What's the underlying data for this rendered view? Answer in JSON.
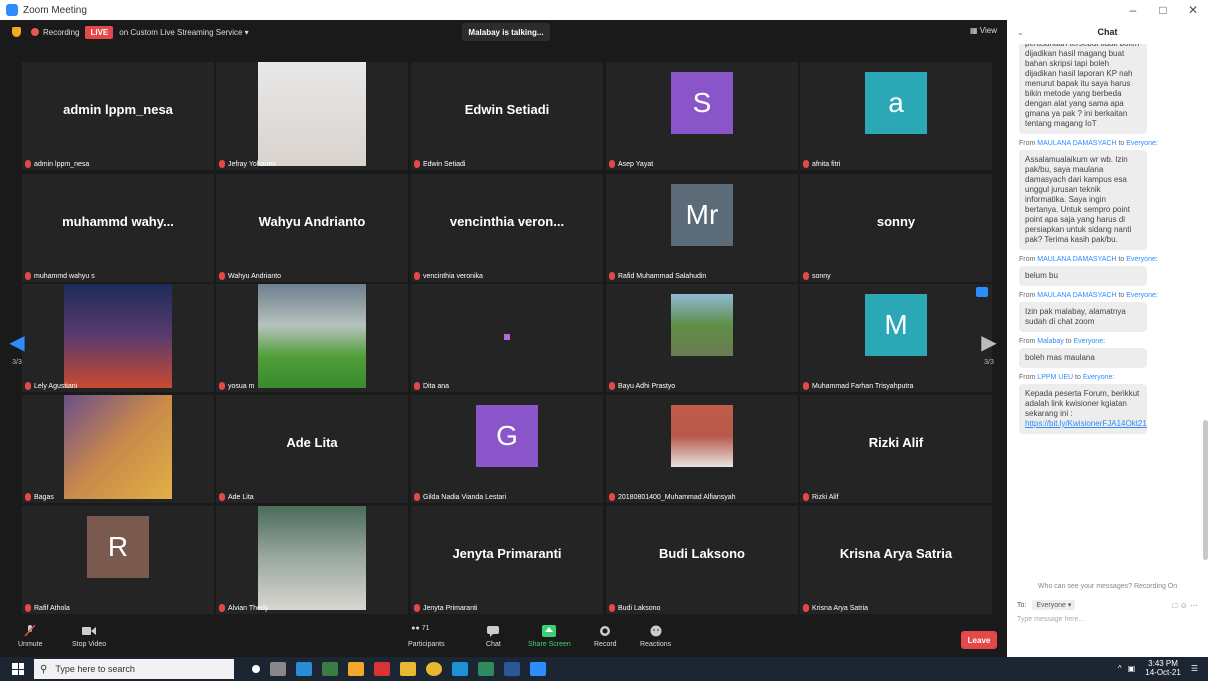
{
  "window": {
    "title": "Zoom Meeting"
  },
  "topbar": {
    "recording": "Recording",
    "live": "LIVE",
    "stream": "on Custom Live Streaming Service",
    "talking": "Malabay is talking...",
    "view": "View"
  },
  "tiles": [
    {
      "id": "t0",
      "display": "admin lppm_nesa",
      "label": "admin lppm_nesa",
      "kind": "name"
    },
    {
      "id": "t1",
      "display": "",
      "label": "Jefray Yohanes",
      "kind": "photo-cartoon"
    },
    {
      "id": "t2",
      "display": "Edwin Setiadi",
      "label": "Edwin Setiadi",
      "kind": "name"
    },
    {
      "id": "t3",
      "display": "S",
      "label": "Asep Yayat",
      "kind": "avatar",
      "color": "#8a55c9"
    },
    {
      "id": "t4",
      "display": "a",
      "label": "afnita fitri",
      "kind": "avatar",
      "color": "#2ba7b5"
    },
    {
      "id": "t5",
      "display": "muhammd  wahy...",
      "label": "muhammd wahyu s",
      "kind": "name"
    },
    {
      "id": "t6",
      "display": "Wahyu Andrianto",
      "label": "Wahyu Andrianto",
      "kind": "name"
    },
    {
      "id": "t7",
      "display": "vencinthia  veron...",
      "label": "vencinthia veronika",
      "kind": "name"
    },
    {
      "id": "t8",
      "display": "Mr",
      "label": "Rafid Muhammad Salahudin",
      "kind": "avatar",
      "color": "#5c6b78"
    },
    {
      "id": "t9",
      "display": "sonny",
      "label": "sonny",
      "kind": "name"
    },
    {
      "id": "t10",
      "display": "",
      "label": "Lely Agustiani",
      "kind": "photo-volcano"
    },
    {
      "id": "t11",
      "display": "",
      "label": "yosua m",
      "kind": "photo-landscape"
    },
    {
      "id": "t12",
      "display": "",
      "label": "Dita ana",
      "kind": "dot"
    },
    {
      "id": "t13",
      "display": "",
      "label": "Bayu Adhi Prastyo",
      "kind": "photo-field"
    },
    {
      "id": "t14",
      "display": "M",
      "label": "Muhammad Farhan Trisyahputra",
      "kind": "avatar",
      "color": "#2ba7b5"
    },
    {
      "id": "t15",
      "display": "",
      "label": "Bagas",
      "kind": "photo-game"
    },
    {
      "id": "t16",
      "display": "Ade Lita",
      "label": "Ade Lita",
      "kind": "name"
    },
    {
      "id": "t17",
      "display": "G",
      "label": "Gilda Nadia Vianda Lestari",
      "kind": "avatar",
      "color": "#8a55c9"
    },
    {
      "id": "t18",
      "display": "",
      "label": "20180801400_Muhammad Alfiansyah",
      "kind": "photo-portrait"
    },
    {
      "id": "t19",
      "display": "Rizki Alif",
      "label": "Rizki Alif",
      "kind": "name"
    },
    {
      "id": "t20",
      "display": "R",
      "label": "Rafif Athola",
      "kind": "avatar",
      "color": "#7a5a4e"
    },
    {
      "id": "t21",
      "display": "",
      "label": "Alvian Thedy",
      "kind": "photo-people"
    },
    {
      "id": "t22",
      "display": "Jenyta Primaranti",
      "label": "Jenyta Primaranti",
      "kind": "name"
    },
    {
      "id": "t23",
      "display": "Budi Laksono",
      "label": "Budi Laksono",
      "kind": "name"
    },
    {
      "id": "t24",
      "display": "Krisna Arya Satria",
      "label": "Krisna Arya Satria",
      "kind": "name"
    }
  ],
  "nav": {
    "page": "3/3"
  },
  "toolbar": {
    "unmute": "Unmute",
    "stop_video": "Stop Video",
    "participants": "Participants",
    "participants_count": "71",
    "chat": "Chat",
    "share": "Share Screen",
    "record": "Record",
    "reactions": "Reactions",
    "leave": "Leave"
  },
  "chat": {
    "title": "Chat",
    "messages": [
      {
        "from": "",
        "to": "",
        "text": "perusahaan tersebut tidak boleh dijadikan hasil magang buat bahan skripsi tapi boleh dijadikan hasil laporan KP nah menurut bapak itu saya harus bikin metode yang berbeda dengan alat yang sama apa gmana ya pak ? ini berkaitan tentang magang IoT"
      },
      {
        "from": "MAULANA DAMASYACH",
        "to": "Everyone",
        "text": "Assalamualaikum wr wb. Izin pak/bu, saya maulana damasyach dari kampus esa unggul jurusan teknik informatika. Saya ingin bertanya. Untuk sempro point point apa saja yang harus di persiapkan untuk sidang nanti pak? Terima kasih pak/bu."
      },
      {
        "from": "MAULANA DAMASYACH",
        "to": "Everyone",
        "text": "belum bu"
      },
      {
        "from": "MAULANA DAMASYACH",
        "to": "Everyone",
        "text": "Izin pak malabay, alamatnya sudah di chat zoom"
      },
      {
        "from": "Malabay",
        "to": "Everyone",
        "text": "boleh mas maulana"
      },
      {
        "from": "LPPM UEU",
        "to": "Everyone",
        "text": "Kepada peserta Forum, berikkut adalah link kwisioner kgiatan sekarang ini :",
        "link": "https://bit.ly/KwisionerFJA14Okt21"
      }
    ],
    "from_word": "From",
    "to_word": "to",
    "who_see": "Who can see your messages? Recording On",
    "to_label": "To:",
    "to_value": "Everyone",
    "placeholder": "Type message here..."
  },
  "taskbar": {
    "search": "Type here to search",
    "time": "3:43 PM",
    "date": "14-Oct-21"
  }
}
